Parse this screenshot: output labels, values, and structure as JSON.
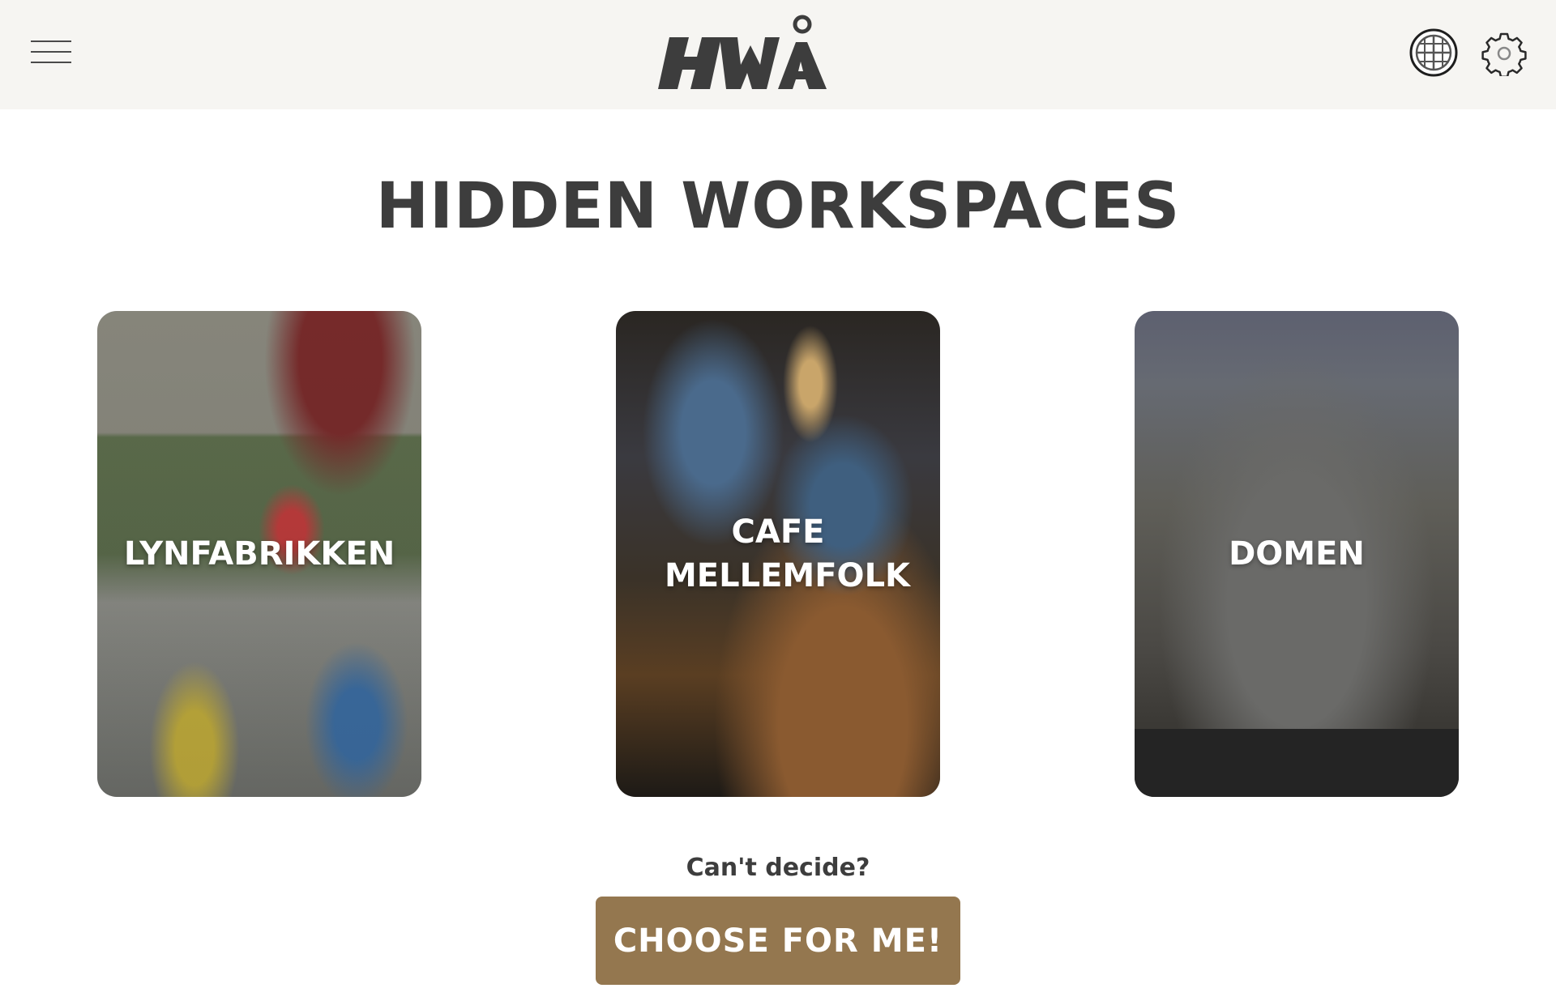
{
  "header": {
    "menu_icon": "hamburger-menu-icon",
    "logo_text": "HWÅ",
    "language_icon": "globe-icon",
    "settings_icon": "gear-icon"
  },
  "main": {
    "title": "HIDDEN WORKSPACES",
    "cards": [
      {
        "label": "LYNFABRIKKEN"
      },
      {
        "label": "CAFE MELLEMFOLK"
      },
      {
        "label": "DOMEN"
      }
    ],
    "prompt": "Can't decide?",
    "choose_button": "CHOOSE FOR ME!"
  },
  "colors": {
    "header_bg": "#f6f5f2",
    "title_text": "#3d3d3d",
    "button_bg": "#94774f",
    "button_text": "#ffffff"
  }
}
